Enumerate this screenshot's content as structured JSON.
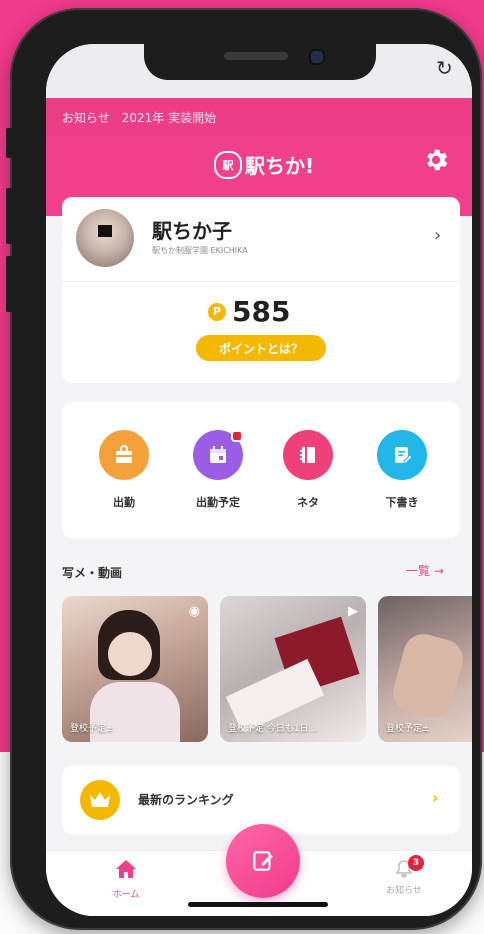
{
  "notice": {
    "text": "お知らせ　2021年 実装開始"
  },
  "header": {
    "logo_text": "駅ちか!",
    "logo_mark": "駅"
  },
  "profile": {
    "name": "駅ちか子",
    "subtitle": "駅ちか制服学園 EKICHIKA",
    "points_icon": "P",
    "points": "585",
    "points_button": "ポイントとは？"
  },
  "actions": [
    {
      "label": "出勤",
      "color": "#f5a13b",
      "icon": "bag-icon"
    },
    {
      "label": "出勤予定",
      "color": "#9b5de5",
      "icon": "calendar-icon",
      "has_dot": true
    },
    {
      "label": "ネタ",
      "color": "#f0407a",
      "icon": "notebook-icon"
    },
    {
      "label": "下書き",
      "color": "#23b6e8",
      "icon": "edit-icon"
    }
  ],
  "media": {
    "title": "写メ・動画",
    "view_all": "一覧",
    "view_all_arrow": "→",
    "items": [
      {
        "caption": "登校予定±",
        "type": "photo"
      },
      {
        "caption": "登校予定 今日も1日...",
        "type": "video"
      },
      {
        "caption": "登校予定±",
        "type": "photo"
      }
    ]
  },
  "ranking": {
    "label": "最新のランキング",
    "chevron": "›"
  },
  "tabbar": {
    "home_label": "ホーム",
    "notifications_label": "お知らせ",
    "notification_badge": "3"
  },
  "colors": {
    "brand_pink": "#f0408c",
    "gold": "#f5b800"
  }
}
